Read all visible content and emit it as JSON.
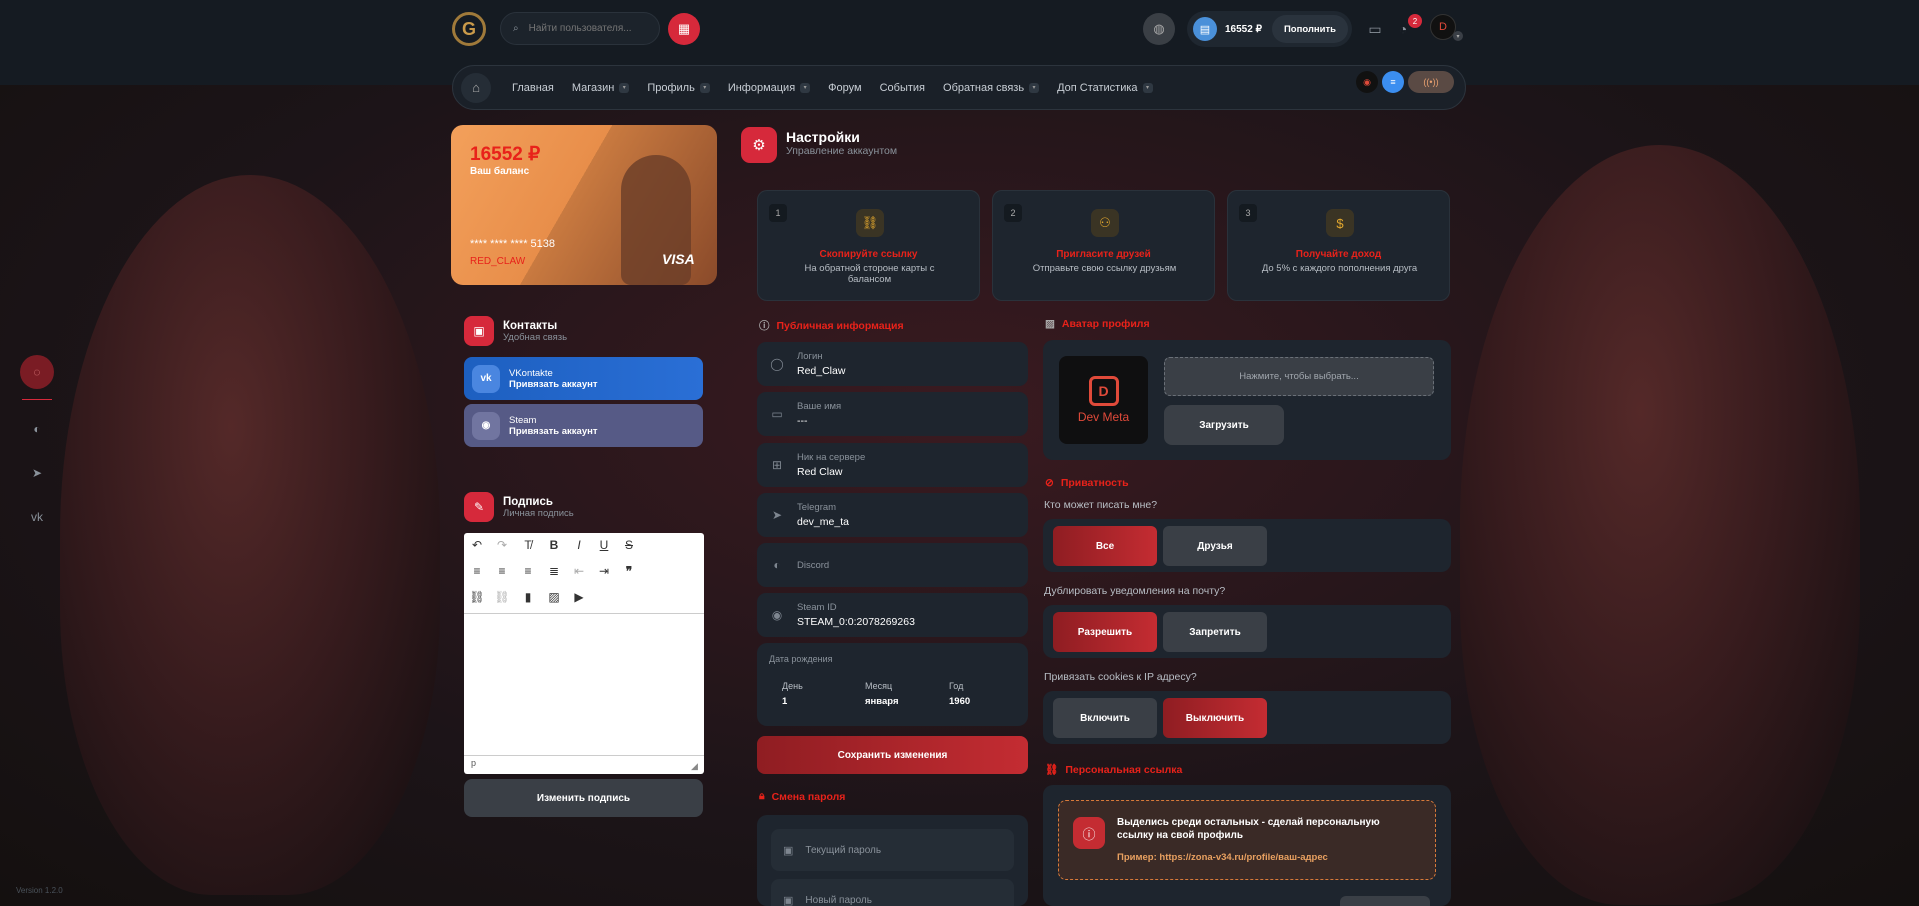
{
  "header": {
    "logo_letter": "G",
    "search_placeholder": "Найти пользователя...",
    "balance": "16552 ₽",
    "topup_label": "Пополнить",
    "notifications_count": "2",
    "avatar_text": "D"
  },
  "nav": {
    "items": [
      {
        "label": "Главная",
        "dropdown": false
      },
      {
        "label": "Магазин",
        "dropdown": true
      },
      {
        "label": "Профиль",
        "dropdown": true
      },
      {
        "label": "Информация",
        "dropdown": true
      },
      {
        "label": "Форум",
        "dropdown": false
      },
      {
        "label": "События",
        "dropdown": false
      },
      {
        "label": "Обратная связь",
        "dropdown": true
      },
      {
        "label": "Доп Статистика",
        "dropdown": true
      }
    ]
  },
  "balance_card": {
    "amount": "16552 ₽",
    "label": "Ваш баланс",
    "number": "**** **** **** 5138",
    "holder": "RED_CLAW",
    "brand": "VISA"
  },
  "contacts": {
    "title": "Контакты",
    "subtitle": "Удобная связь",
    "vk_name": "VKontakte",
    "vk_action": "Привязать аккаунт",
    "steam_name": "Steam",
    "steam_action": "Привязать аккаунт"
  },
  "signature": {
    "title": "Подпись",
    "subtitle": "Личная подпись",
    "status_path": "p",
    "button": "Изменить подпись"
  },
  "settings": {
    "title": "Настройки",
    "subtitle": "Управление аккаунтом"
  },
  "steps": [
    {
      "no": "1",
      "title": "Скопируйте ссылку",
      "desc": "На обратной стороне карты с балансом"
    },
    {
      "no": "2",
      "title": "Пригласите друзей",
      "desc": "Отправьте свою ссылку друзьям"
    },
    {
      "no": "3",
      "title": "Получайте доход",
      "desc": "До 5% с каждого пополнения друга"
    }
  ],
  "public_info": {
    "title": "Публичная информация",
    "login_label": "Логин",
    "login_value": "Red_Claw",
    "name_label": "Ваше имя",
    "name_value": "---",
    "nick_label": "Ник на сервере",
    "nick_value": "Red Claw",
    "telegram_label": "Telegram",
    "telegram_value": "dev_me_ta",
    "discord_label": "Discord",
    "steam_label": "Steam ID",
    "steam_value": "STEAM_0:0:2078269263",
    "birth_label": "Дата рождения",
    "day_label": "День",
    "day_value": "1",
    "month_label": "Месяц",
    "month_value": "января",
    "year_label": "Год",
    "year_value": "1960",
    "save_button": "Сохранить изменения"
  },
  "password": {
    "title": "Смена пароля",
    "current_placeholder": "Текущий пароль",
    "new_placeholder": "Новый пароль"
  },
  "avatar_section": {
    "title": "Аватар профиля",
    "brand": "Dev Meta",
    "file_placeholder": "Нажмите, чтобы выбрать...",
    "upload_button": "Загрузить"
  },
  "privacy": {
    "title": "Приватность",
    "q1": "Кто может писать мне?",
    "q1_opt1": "Все",
    "q1_opt2": "Друзья",
    "q2": "Дублировать уведомления на почту?",
    "q2_opt1": "Разрешить",
    "q2_opt2": "Запретить",
    "q3": "Привязать cookies к IP адресу?",
    "q3_opt1": "Включить",
    "q3_opt2": "Выключить"
  },
  "personal_link": {
    "title": "Персональная ссылка",
    "text": "Выделись среди остальных - сделай персональную ссылку на свой профиль",
    "example": "Пример: https://zona-v34.ru/profile/ваш-адрес"
  },
  "version": "Version 1.2.0",
  "colors": {
    "accent": "#d6293b",
    "background": "#141a20",
    "panel": "#1e252e"
  }
}
